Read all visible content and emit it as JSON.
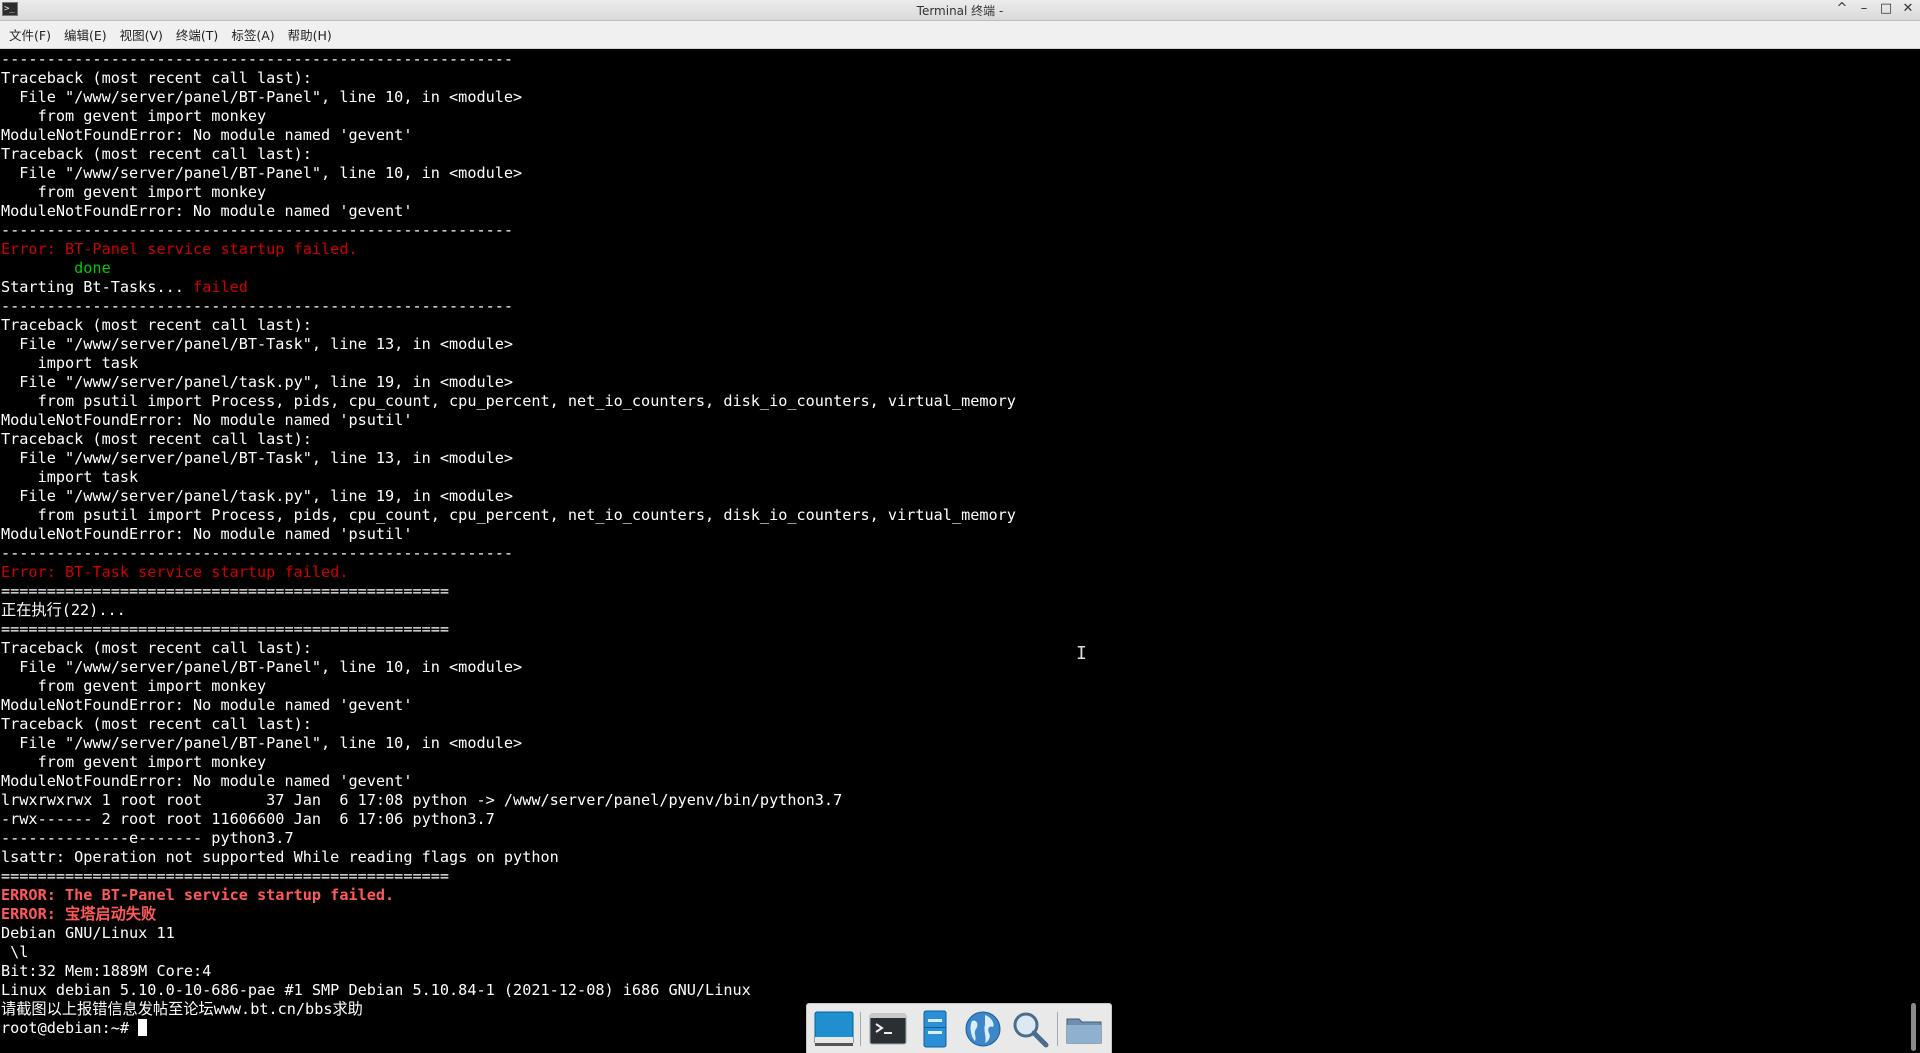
{
  "window": {
    "title": "Terminal 终端 -",
    "controls": [
      "^",
      "–",
      "□",
      "✕"
    ]
  },
  "menu": [
    "文件(F)",
    "编辑(E)",
    "视图(V)",
    "终端(T)",
    "标签(A)",
    "帮助(H)"
  ],
  "terminal": {
    "lines": [
      {
        "t": "--------------------------------------------------------"
      },
      {
        "t": "Traceback (most recent call last):"
      },
      {
        "t": "  File \"/www/server/panel/BT-Panel\", line 10, in <module>"
      },
      {
        "t": "    from gevent import monkey"
      },
      {
        "t": "ModuleNotFoundError: No module named 'gevent'"
      },
      {
        "t": "Traceback (most recent call last):"
      },
      {
        "t": "  File \"/www/server/panel/BT-Panel\", line 10, in <module>"
      },
      {
        "t": "    from gevent import monkey"
      },
      {
        "t": "ModuleNotFoundError: No module named 'gevent'"
      },
      {
        "t": "--------------------------------------------------------"
      },
      {
        "t": "Error: BT-Panel service startup failed.",
        "c": "err"
      },
      {
        "t": "        done",
        "c": "ok"
      },
      {
        "t": "Starting Bt-Tasks... ",
        "tail": "failed",
        "tc": "err"
      },
      {
        "t": "--------------------------------------------------------"
      },
      {
        "t": "Traceback (most recent call last):"
      },
      {
        "t": "  File \"/www/server/panel/BT-Task\", line 13, in <module>"
      },
      {
        "t": "    import task"
      },
      {
        "t": "  File \"/www/server/panel/task.py\", line 19, in <module>"
      },
      {
        "t": "    from psutil import Process, pids, cpu_count, cpu_percent, net_io_counters, disk_io_counters, virtual_memory"
      },
      {
        "t": "ModuleNotFoundError: No module named 'psutil'"
      },
      {
        "t": "Traceback (most recent call last):"
      },
      {
        "t": "  File \"/www/server/panel/BT-Task\", line 13, in <module>"
      },
      {
        "t": "    import task"
      },
      {
        "t": "  File \"/www/server/panel/task.py\", line 19, in <module>"
      },
      {
        "t": "    from psutil import Process, pids, cpu_count, cpu_percent, net_io_counters, disk_io_counters, virtual_memory"
      },
      {
        "t": "ModuleNotFoundError: No module named 'psutil'"
      },
      {
        "t": "--------------------------------------------------------"
      },
      {
        "t": "Error: BT-Task service startup failed.",
        "c": "err"
      },
      {
        "t": "================================================="
      },
      {
        "t": "正在执行(22)..."
      },
      {
        "t": "================================================="
      },
      {
        "t": "Traceback (most recent call last):"
      },
      {
        "t": "  File \"/www/server/panel/BT-Panel\", line 10, in <module>"
      },
      {
        "t": "    from gevent import monkey"
      },
      {
        "t": "ModuleNotFoundError: No module named 'gevent'"
      },
      {
        "t": "Traceback (most recent call last):"
      },
      {
        "t": "  File \"/www/server/panel/BT-Panel\", line 10, in <module>"
      },
      {
        "t": "    from gevent import monkey"
      },
      {
        "t": "ModuleNotFoundError: No module named 'gevent'"
      },
      {
        "t": "lrwxrwxrwx 1 root root       37 Jan  6 17:08 python -> /www/server/panel/pyenv/bin/python3.7"
      },
      {
        "t": "-rwx------ 2 root root 11606600 Jan  6 17:06 python3.7"
      },
      {
        "t": "--------------e------- python3.7"
      },
      {
        "t": "lsattr: Operation not supported While reading flags on python"
      },
      {
        "t": "================================================="
      },
      {
        "t": "ERROR: The BT-Panel service startup failed.",
        "c": "bold"
      },
      {
        "t": "ERROR: 宝塔启动失败",
        "c": "bold"
      },
      {
        "t": "Debian GNU/Linux 11"
      },
      {
        "t": " \\l"
      },
      {
        "t": "Bit:32 Mem:1889M Core:4"
      },
      {
        "t": "Linux debian 5.10.0-10-686-pae #1 SMP Debian 5.10.84-1 (2021-12-08) i686 GNU/Linux"
      },
      {
        "t": "请截图以上报错信息发帖至论坛www.bt.cn/bbs求助"
      },
      {
        "t": "root@debian:~# ",
        "cursor": true
      }
    ]
  },
  "dock": [
    {
      "name": "show-desktop-icon"
    },
    {
      "name": "terminal-icon"
    },
    {
      "name": "file-manager-icon"
    },
    {
      "name": "web-browser-icon"
    },
    {
      "name": "app-finder-icon"
    },
    {
      "name": "folder-icon"
    }
  ],
  "colors": {
    "error": "#cd0000",
    "ok": "#00cd00",
    "bold_error": "#ff5a5a",
    "background": "#000000",
    "foreground": "#ffffff"
  }
}
